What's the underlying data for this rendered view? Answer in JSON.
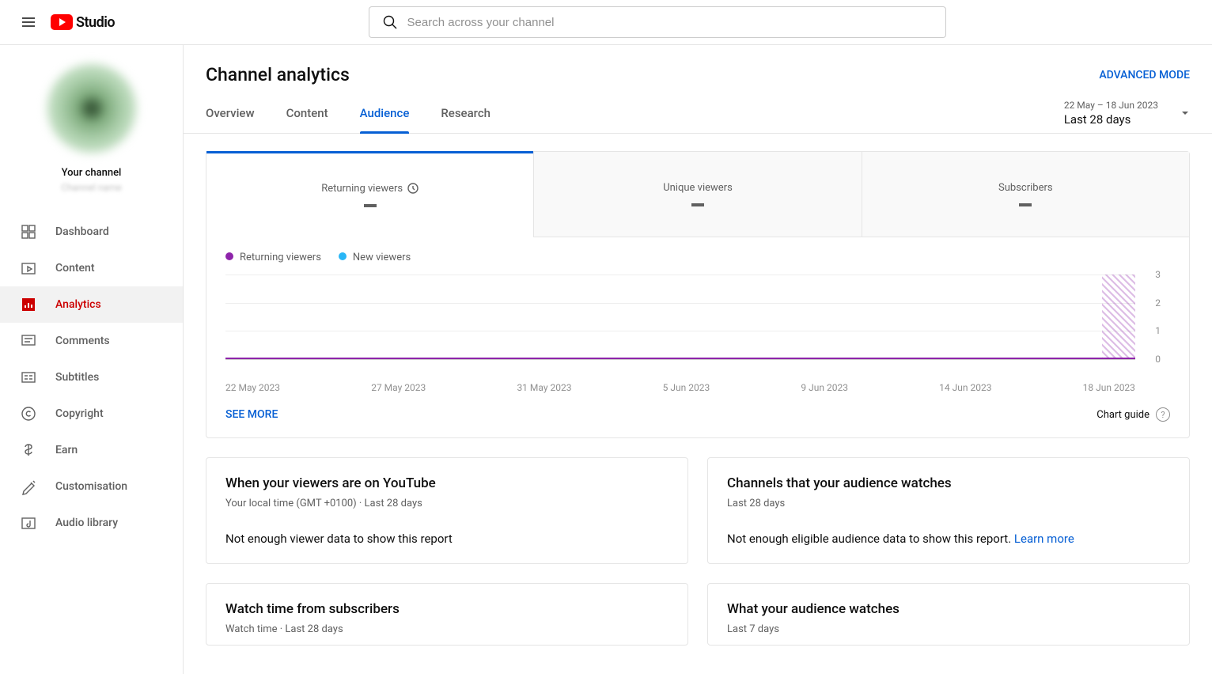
{
  "header": {
    "logo_text": "Studio",
    "search_placeholder": "Search across your channel"
  },
  "sidebar": {
    "your_channel_label": "Your channel",
    "your_channel_sub": "Channel name",
    "items": [
      {
        "label": "Dashboard"
      },
      {
        "label": "Content"
      },
      {
        "label": "Analytics"
      },
      {
        "label": "Comments"
      },
      {
        "label": "Subtitles"
      },
      {
        "label": "Copyright"
      },
      {
        "label": "Earn"
      },
      {
        "label": "Customisation"
      },
      {
        "label": "Audio library"
      }
    ]
  },
  "main": {
    "title": "Channel analytics",
    "advanced_mode": "ADVANCED MODE",
    "tabs": [
      {
        "label": "Overview"
      },
      {
        "label": "Content"
      },
      {
        "label": "Audience"
      },
      {
        "label": "Research"
      }
    ],
    "date_picker": {
      "range": "22 May – 18 Jun 2023",
      "label": "Last 28 days"
    }
  },
  "metrics": {
    "tabs": [
      {
        "title": "Returning viewers",
        "value": "—",
        "has_icon": true
      },
      {
        "title": "Unique viewers",
        "value": "—"
      },
      {
        "title": "Subscribers",
        "value": "—"
      }
    ],
    "legend": [
      {
        "label": "Returning viewers",
        "color": "#8e24aa"
      },
      {
        "label": "New viewers",
        "color": "#29b6f6"
      }
    ],
    "see_more": "SEE MORE",
    "chart_guide": "Chart guide"
  },
  "chart_data": {
    "type": "line",
    "xlabel": "",
    "ylabel": "",
    "ylim": [
      0,
      3
    ],
    "yticks": [
      0,
      1,
      2,
      3
    ],
    "x": [
      "22 May 2023",
      "27 May 2023",
      "31 May 2023",
      "5 Jun 2023",
      "9 Jun 2023",
      "14 Jun 2023",
      "18 Jun 2023"
    ],
    "series": [
      {
        "name": "Returning viewers",
        "color": "#8e24aa",
        "values": [
          0,
          0,
          0,
          0,
          0,
          0,
          0
        ]
      },
      {
        "name": "New viewers",
        "color": "#29b6f6",
        "values": [
          0,
          0,
          0,
          0,
          0,
          0,
          0
        ]
      }
    ],
    "future_region_start": "18 Jun 2023"
  },
  "cards": {
    "viewers_on_yt": {
      "title": "When your viewers are on YouTube",
      "sub": "Your local time (GMT +0100) · Last 28 days",
      "body": "Not enough viewer data to show this report"
    },
    "channels": {
      "title": "Channels that your audience watches",
      "sub": "Last 28 days",
      "body": "Not enough eligible audience data to show this report. ",
      "learn_more": "Learn more"
    },
    "watch_time": {
      "title": "Watch time from subscribers",
      "sub": "Watch time · Last 28 days"
    },
    "audience_watches": {
      "title": "What your audience watches",
      "sub": "Last 7 days"
    }
  }
}
